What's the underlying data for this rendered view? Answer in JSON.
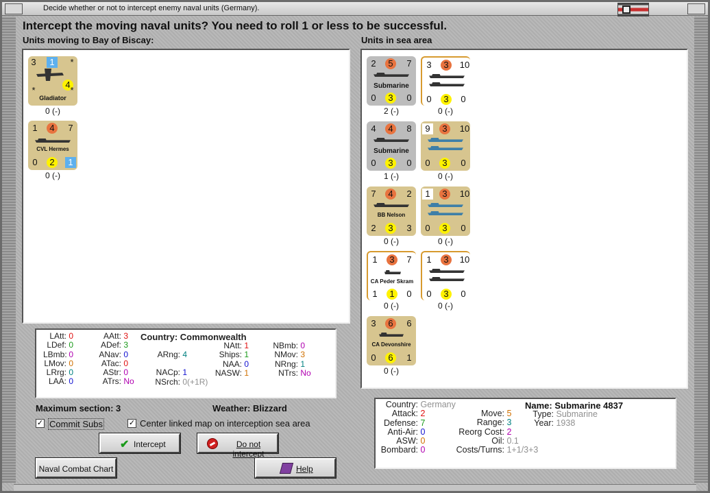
{
  "window": {
    "title": "Decide whether or not to intercept enemy naval units (Germany)."
  },
  "heading": "Intercept the moving naval units?  You need to roll 1 or less to be successful.",
  "left_section": {
    "label": "Units moving to Bay of Biscay:",
    "units": [
      {
        "name": "Gladiator",
        "tl": "3",
        "tm": "1",
        "tr": "*",
        "ml": "*",
        "mr": "4",
        "br": "*",
        "status": "0 (-)",
        "kind": "aircraft"
      },
      {
        "name": "CVL Hermes",
        "tl": "1",
        "tm": "4",
        "tr": "7",
        "bl": "0",
        "bm": "2",
        "br": "1",
        "status": "0 (-)",
        "kind": "carrier"
      }
    ]
  },
  "right_section": {
    "label": "Units in sea area",
    "units": [
      {
        "name": "Submarine",
        "tl": "2",
        "tm": "5",
        "tr": "7",
        "bl": "0",
        "bm": "3",
        "br": "0",
        "status": "2 (-)"
      },
      {
        "name": "",
        "tl": "3",
        "tm": "3",
        "tr": "10",
        "bl": "0",
        "bm": "3",
        "br": "0",
        "status": "0 (-)"
      },
      {
        "name": "Submarine",
        "tl": "4",
        "tm": "4",
        "tr": "8",
        "bl": "0",
        "bm": "3",
        "br": "0",
        "status": "1 (-)"
      },
      {
        "name": "",
        "tl": "9",
        "tm": "3",
        "tr": "10",
        "bl": "0",
        "bm": "3",
        "br": "0",
        "status": "0 (-)"
      },
      {
        "name": "BB Nelson",
        "tl": "7",
        "tm": "4",
        "tr": "2",
        "bl": "2",
        "bm": "3",
        "br": "3",
        "status": "0 (-)"
      },
      {
        "name": "",
        "tl": "1",
        "tm": "3",
        "tr": "10",
        "bl": "0",
        "bm": "3",
        "br": "0",
        "status": "0 (-)"
      },
      {
        "name": "CA Peder Skram",
        "tl": "1",
        "tm": "3",
        "tr": "7",
        "bl": "1",
        "bm": "1",
        "br": "0",
        "status": "0 (-)"
      },
      {
        "name": "",
        "tl": "1",
        "tm": "3",
        "tr": "10",
        "bl": "0",
        "bm": "3",
        "br": "0",
        "status": "0 (-)"
      },
      {
        "name": "CA Devonshire",
        "tl": "3",
        "tm": "6",
        "tr": "6",
        "bl": "0",
        "bm": "6",
        "br": "1",
        "status": "0 (-)"
      }
    ]
  },
  "stats_left": {
    "latt": {
      "label": "LAtt:",
      "value": "0"
    },
    "ldef": {
      "label": "LDef:",
      "value": "0"
    },
    "lbmb": {
      "label": "LBmb:",
      "value": "0"
    },
    "lmov": {
      "label": "LMov:",
      "value": "0"
    },
    "lrrg": {
      "label": "LRrg:",
      "value": "0"
    },
    "laa": {
      "label": "LAA:",
      "value": "0"
    },
    "aatt": {
      "label": "AAtt:",
      "value": "3"
    },
    "adef": {
      "label": "ADef:",
      "value": "3"
    },
    "anav": {
      "label": "ANav:",
      "value": "0"
    },
    "atac": {
      "label": "ATac:",
      "value": "0"
    },
    "astr": {
      "label": "AStr:",
      "value": "0"
    },
    "atrs": {
      "label": "ATrs:",
      "value": "No"
    },
    "country_label": "Country:",
    "country": "Commonwealth",
    "arng": {
      "label": "ARng:",
      "value": "4"
    },
    "nacp": {
      "label": "NACp:",
      "value": "1"
    },
    "nsrch": {
      "label": "NSrch:",
      "value": "0(+1R)"
    },
    "natt": {
      "label": "NAtt:",
      "value": "1"
    },
    "ships": {
      "label": "Ships:",
      "value": "1"
    },
    "naa": {
      "label": "NAA:",
      "value": "0"
    },
    "nasw": {
      "label": "NASW:",
      "value": "1"
    },
    "nbmb": {
      "label": "NBmb:",
      "value": "0"
    },
    "nmov": {
      "label": "NMov:",
      "value": "3"
    },
    "nrng": {
      "label": "NRng:",
      "value": "1"
    },
    "ntrs": {
      "label": "NTrs:",
      "value": "No"
    }
  },
  "controls": {
    "max_section": "Maximum section: 3",
    "weather": "Weather:  Blizzard",
    "commit_subs": "Commit Subs",
    "center_map": "Center linked map on interception sea area",
    "intercept": "Intercept",
    "do_not_intercept": "Do not intercept",
    "naval_chart": "Naval Combat Chart",
    "help": "Help"
  },
  "unit_info": {
    "country_label": "Country:",
    "country": "Germany",
    "attack_label": "Attack:",
    "attack": "2",
    "defense_label": "Defense:",
    "defense": "7",
    "antiair_label": "Anti-Air:",
    "antiair": "0",
    "asw_label": "ASW:",
    "asw": "0",
    "bombard_label": "Bombard:",
    "bombard": "0",
    "move_label": "Move:",
    "move": "5",
    "range_label": "Range:",
    "range": "3",
    "reorg_label": "Reorg Cost:",
    "reorg": "2",
    "oil_label": "Oil:",
    "oil": "0.1",
    "costs_label": "Costs/Turns:",
    "costs": "1+1/3+3",
    "name_label": "Name:",
    "name": "Submarine 4837",
    "type_label": "Type:",
    "type": "Submarine",
    "year_label": "Year:",
    "year": "1938"
  },
  "colors": {
    "red": "#e01010",
    "green": "#1a9a1a",
    "blue": "#1010d0",
    "purple": "#b000b0",
    "teal": "#008080",
    "orange": "#d07000",
    "gray": "#909090"
  }
}
